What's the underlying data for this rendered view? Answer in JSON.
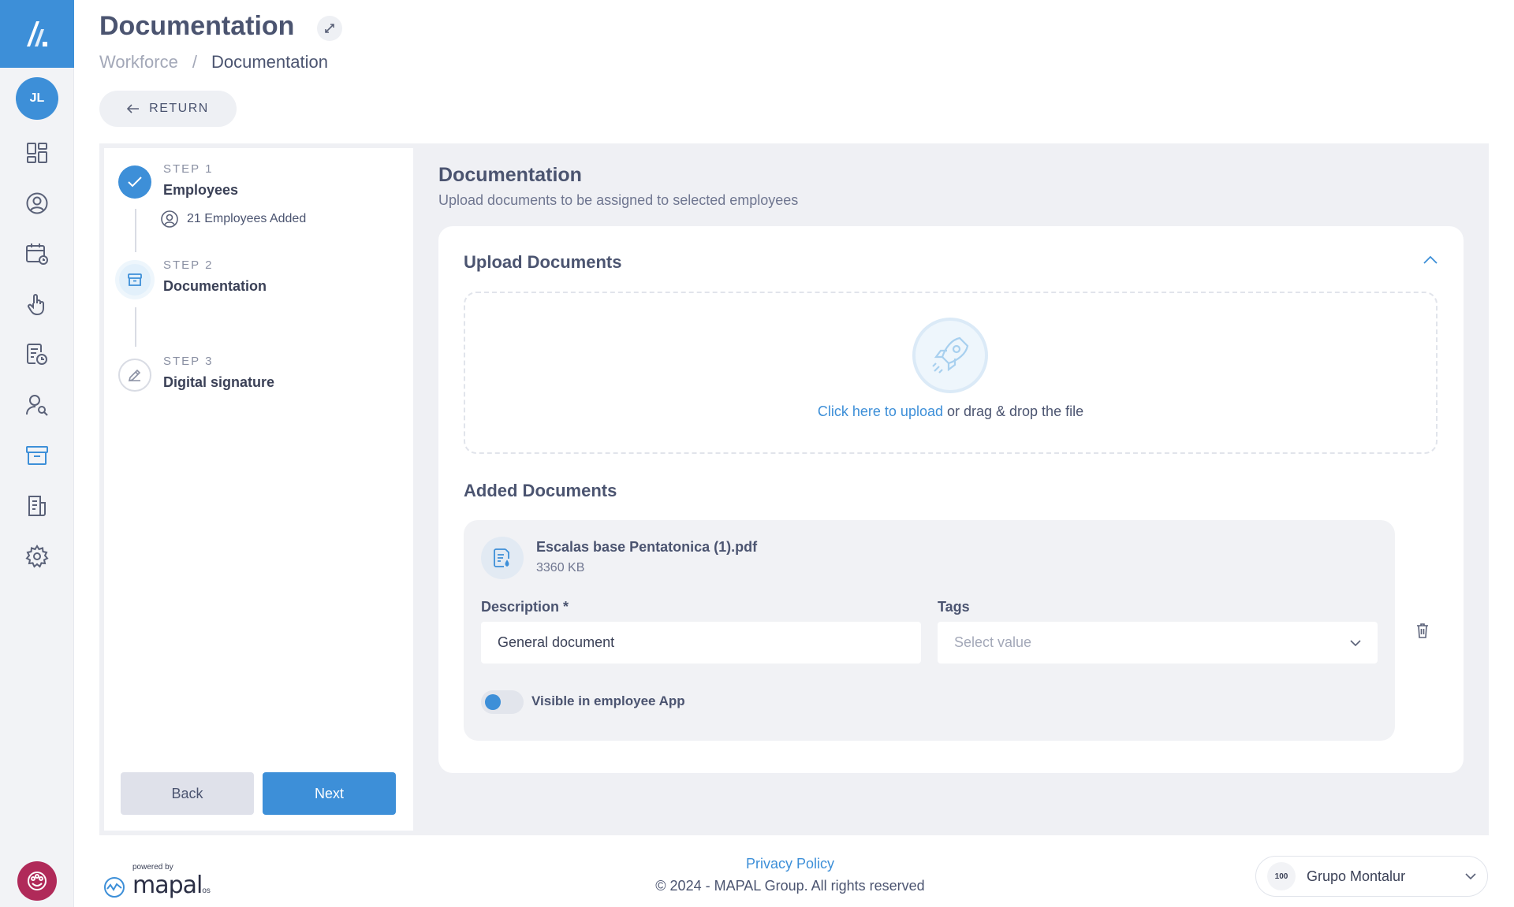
{
  "header": {
    "title": "Documentation",
    "breadcrumb": [
      "Workforce",
      "/",
      "Documentation"
    ],
    "return_label": "RETURN"
  },
  "user": {
    "initials": "JL"
  },
  "rail": {
    "icons": [
      "dashboard-icon",
      "user-circle-icon",
      "calendar-clock-icon",
      "touch-icon",
      "document-clock-icon",
      "user-search-icon",
      "archive-icon",
      "report-icon",
      "gear-icon"
    ]
  },
  "steps": [
    {
      "number": "STEP 1",
      "name": "Employees",
      "status": "done",
      "meta": "21 Employees Added"
    },
    {
      "number": "STEP 2",
      "name": "Documentation",
      "status": "current"
    },
    {
      "number": "STEP 3",
      "name": "Digital signature",
      "status": "pending"
    }
  ],
  "nav": {
    "back_label": "Back",
    "next_label": "Next"
  },
  "main": {
    "title": "Documentation",
    "subtitle": "Upload documents to be assigned to selected employees",
    "upload": {
      "title": "Upload Documents",
      "link_text": "Click here to upload",
      "rest_text": " or drag & drop the file"
    },
    "added": {
      "title": "Added Documents",
      "file_name": "Escalas base Pentatonica (1).pdf",
      "file_size": "3360 KB",
      "description_label": "Description",
      "required_mark": "*",
      "description_value": "General document",
      "tags_label": "Tags",
      "tags_placeholder": "Select value",
      "visible_label": "Visible in employee App"
    }
  },
  "footer": {
    "powered_by": "powered by",
    "brand": "mapal",
    "brand_suffix": "os",
    "privacy": "Privacy Policy",
    "copyright": "© 2024 - MAPAL Group. All rights reserved",
    "company_logo_text": "100",
    "company_name": "Grupo Montalur"
  },
  "colors": {
    "accent": "#3d8fd8",
    "text": "#4b5470",
    "muted": "#a3a8b8",
    "frame": "#eff0f4"
  }
}
